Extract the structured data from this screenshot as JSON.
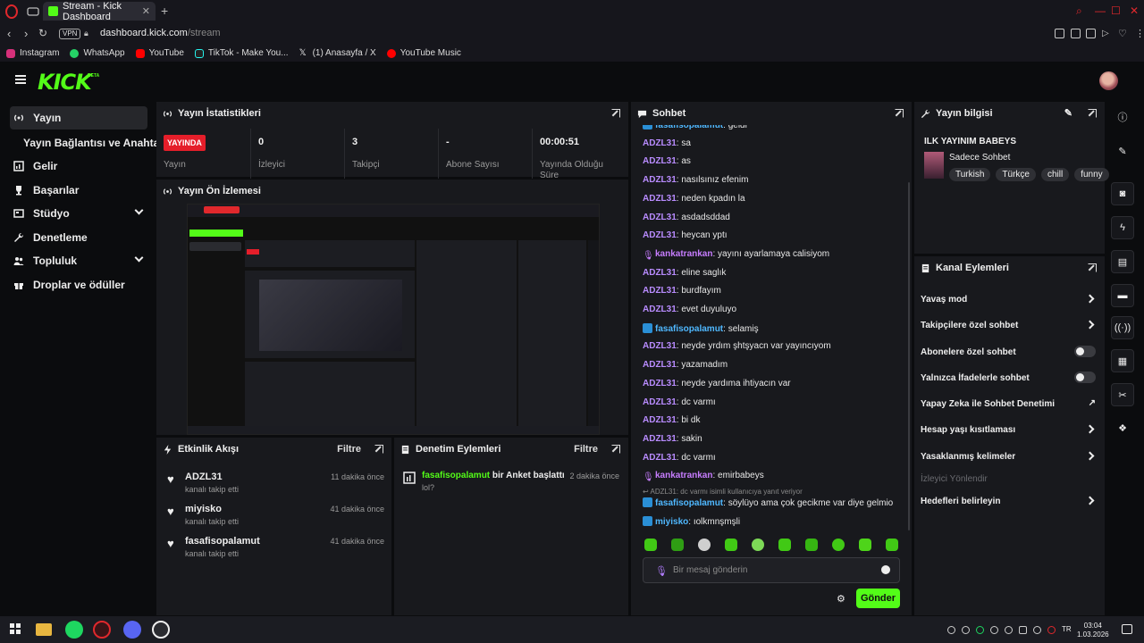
{
  "browser": {
    "tab_title": "Stream - Kick Dashboard",
    "url_domain": "dashboard.kick.com",
    "url_path": "/stream",
    "vpn_label": "VPN",
    "bookmarks": [
      "Instagram",
      "WhatsApp",
      "YouTube",
      "TikTok - Make You...",
      "(1) Anasayfa / X",
      "YouTube Music"
    ]
  },
  "sidebar": {
    "items": [
      {
        "label": "Yayın",
        "icon": "broadcast-icon"
      },
      {
        "label": "Yayın Bağlantısı ve Anahtarı"
      },
      {
        "label": "Gelir",
        "icon": "chart-icon"
      },
      {
        "label": "Başarılar",
        "icon": "trophy-icon"
      },
      {
        "label": "Stüdyo",
        "icon": "studio-icon"
      },
      {
        "label": "Denetleme",
        "icon": "wrench-icon"
      },
      {
        "label": "Topluluk",
        "icon": "users-icon"
      },
      {
        "label": "Droplar ve ödüller",
        "icon": "gift-icon"
      }
    ]
  },
  "stats": {
    "title": "Yayın İstatistikleri",
    "live_badge": "YAYINDA",
    "live_label": "Yayın",
    "viewers_value": "0",
    "viewers_label": "İzleyici",
    "followers_value": "3",
    "followers_label": "Takipçi",
    "subs_value": "-",
    "subs_label": "Abone Sayısı",
    "uptime_value": "00:00:51",
    "uptime_label": "Yayında Olduğu Süre"
  },
  "preview": {
    "title": "Yayın Ön İzlemesi"
  },
  "activity": {
    "title": "Etkinlik Akışı",
    "filter": "Filtre",
    "items": [
      {
        "name": "ADZL31",
        "sub": "kanalı takip etti",
        "time": "11 dakika önce"
      },
      {
        "name": "miyisko",
        "sub": "kanalı takip etti",
        "time": "41 dakika önce"
      },
      {
        "name": "fasafisopalamut",
        "sub": "kanalı takip etti",
        "time": "41 dakika önce"
      }
    ]
  },
  "moderation": {
    "title": "Denetim Eylemleri",
    "filter": "Filtre",
    "item_user": "fasafisopalamut",
    "item_action": "bir Anket başlattı",
    "item_sub": "lol?",
    "item_time": "2 dakika önce"
  },
  "chat": {
    "title": "Sohbet",
    "messages": [
      {
        "user": "fasafisopalamut",
        "text": "geldi",
        "color": "#4fb8ff",
        "badge": "#2a8fd6"
      },
      {
        "user": "ADZL31",
        "text": "sa",
        "color": "#b98cff"
      },
      {
        "user": "ADZL31",
        "text": "as",
        "color": "#b98cff"
      },
      {
        "user": "ADZL31",
        "text": "nasılsınız efenim",
        "color": "#b98cff"
      },
      {
        "user": "ADZL31",
        "text": "neden kpadın la",
        "color": "#b98cff"
      },
      {
        "user": "ADZL31",
        "text": "asdadsddad",
        "color": "#b98cff"
      },
      {
        "user": "ADZL31",
        "text": "heycan yptı",
        "color": "#b98cff"
      },
      {
        "user": "kankatrankan",
        "text": "yayını ayarlamaya calisiyom",
        "color": "#c77dff",
        "badge": "mic"
      },
      {
        "user": "ADZL31",
        "text": "eline saglık",
        "color": "#b98cff"
      },
      {
        "user": "ADZL31",
        "text": "burdfayım",
        "color": "#b98cff"
      },
      {
        "user": "ADZL31",
        "text": "evet duyuluyo",
        "color": "#b98cff"
      },
      {
        "user": "fasafisopalamut",
        "text": "selamiş",
        "color": "#4fb8ff",
        "badge": "#2a8fd6"
      },
      {
        "user": "ADZL31",
        "text": "neyde yrdım şhtşyacn var yayıncıyom",
        "color": "#b98cff"
      },
      {
        "user": "ADZL31",
        "text": "yazamadım",
        "color": "#b98cff"
      },
      {
        "user": "ADZL31",
        "text": "neyde yardıma ihtiyacın var",
        "color": "#b98cff"
      },
      {
        "user": "ADZL31",
        "text": "dc varmı",
        "color": "#b98cff"
      },
      {
        "user": "ADZL31",
        "text": "bi dk",
        "color": "#b98cff"
      },
      {
        "user": "ADZL31",
        "text": "sakin",
        "color": "#b98cff"
      },
      {
        "user": "ADZL31",
        "text": "dc varmı",
        "color": "#b98cff"
      },
      {
        "user": "kankatrankan",
        "text": "emirbabeys",
        "color": "#c77dff",
        "badge": "mic"
      }
    ],
    "reply_note": "ADZL31: dc varmı isimli kullanıcıya yanıt veriyor",
    "after_reply": [
      {
        "user": "fasafisopalamut",
        "text": "söylüyo ama çok gecikme var diye gelmio",
        "color": "#4fb8ff",
        "badge": "#2a8fd6"
      },
      {
        "user": "miyisko",
        "text": "ıolkmnşmşli",
        "color": "#4fb8ff",
        "badge": "#2a8fd6"
      }
    ],
    "input_placeholder": "Bir mesaj gönderin",
    "send_label": "Gönder"
  },
  "stream_info": {
    "title": "Yayın bilgisi",
    "stream_title": "ILK YAYINIM BABEYS",
    "category": "Sadece Sohbet",
    "tags": [
      "Turkish",
      "Türkçe",
      "chill",
      "funny"
    ]
  },
  "channel_actions": {
    "title": "Kanal Eylemleri",
    "items": [
      {
        "label": "Yavaş mod",
        "kind": "chevron"
      },
      {
        "label": "Takipçilere özel sohbet",
        "kind": "chevron"
      },
      {
        "label": "Abonelere özel sohbet",
        "kind": "toggle"
      },
      {
        "label": "Yalnızca İfadelerle sohbet",
        "kind": "toggle"
      },
      {
        "label": "Yapay Zeka ile Sohbet Denetimi",
        "kind": "external"
      },
      {
        "label": "Hesap yaşı kısıtlaması",
        "kind": "chevron"
      },
      {
        "label": "Yasaklanmış kelimeler",
        "kind": "chevron"
      }
    ],
    "section_label": "İzleyici Yönlendir",
    "goals_label": "Hedefleri belirleyin"
  },
  "taskbar": {
    "time": "03:04",
    "date": "1.03.2026"
  },
  "colors": {
    "accent": "#53fc18",
    "live": "#e51e2a",
    "panel": "#18191d",
    "background": "#0b0c0e"
  }
}
